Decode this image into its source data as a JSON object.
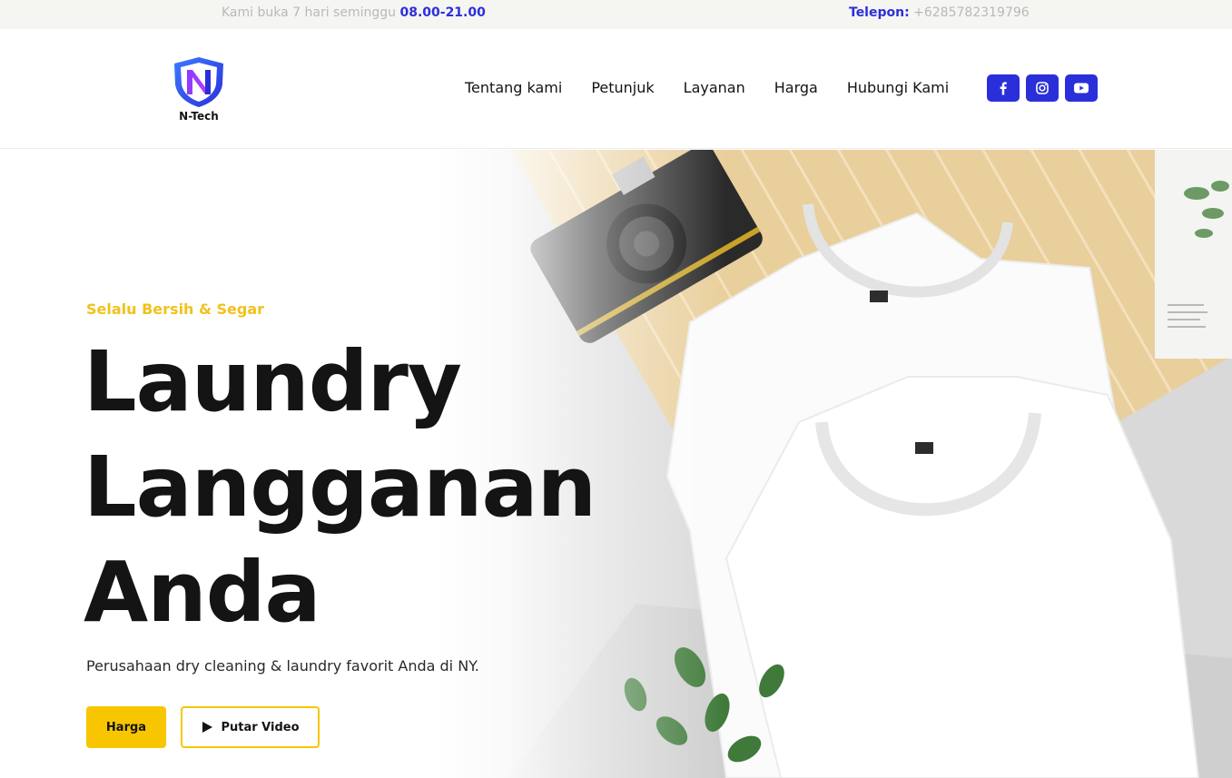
{
  "topbar": {
    "hours_label": "Kami buka 7 hari seminggu",
    "hours_value": "08.00-21.00",
    "phone_label": "Telepon:",
    "phone_value": "+6285782319796"
  },
  "brand": {
    "logo_text": "N-Tech",
    "accent_color": "#2b2fd9"
  },
  "nav": {
    "items": [
      "Tentang kami",
      "Petunjuk",
      "Layanan",
      "Harga",
      "Hubungi Kami"
    ]
  },
  "social": {
    "icons": [
      "facebook-icon",
      "instagram-icon",
      "youtube-icon"
    ]
  },
  "hero": {
    "tagline": "Selalu Bersih & Segar",
    "headline_lines": [
      "Laundry",
      "Langganan",
      "Anda"
    ],
    "subtext": "Perusahaan dry cleaning & laundry favorit Anda di NY.",
    "primary_button": "Harga",
    "secondary_button": "Putar Video",
    "tagline_color": "#f1c21b",
    "button_color": "#f7c600"
  }
}
